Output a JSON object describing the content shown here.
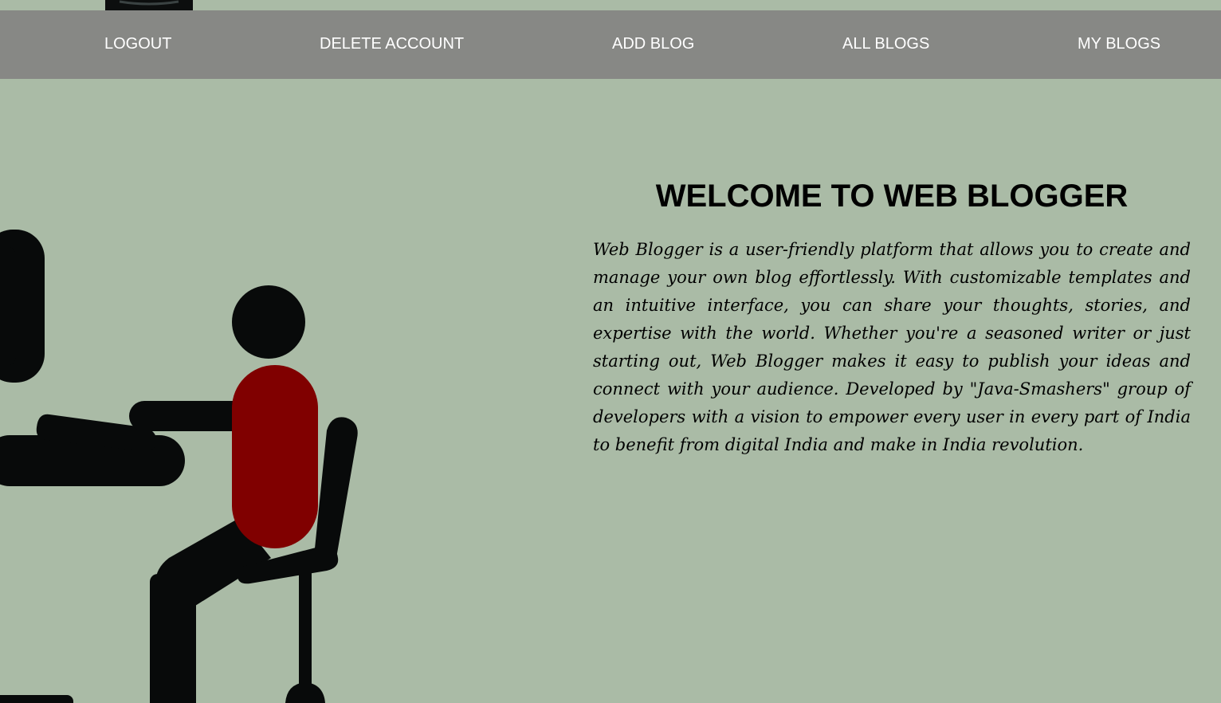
{
  "nav": {
    "logout": "LOGOUT",
    "delete_account": "DELETE ACCOUNT",
    "add_blog": "ADD BLOG",
    "all_blogs": "ALL BLOGS",
    "my_blogs": "MY BLOGS"
  },
  "hero": {
    "title": "WELCOME TO WEB BLOGGER",
    "description": "Web Blogger is a user-friendly platform that allows you to create and manage your own blog effortlessly. With customizable templates and an intuitive interface, you can share your thoughts, stories, and expertise with the world. Whether you're a seasoned writer or just starting out, Web Blogger makes it easy to publish your ideas and connect with your audience. Developed by \"Java-Smashers\" group of developers with a vision to empower every user in every part of India to benefit from digital India and make in India revolution."
  },
  "colors": {
    "background": "#aabba6",
    "navbar": "#878885",
    "nav_text": "#ffffff",
    "figure": "#080a0a",
    "shirt": "#800000"
  },
  "icons": {
    "lamp": "hanging-lamp-icon",
    "illustration": "person-at-computer-illustration"
  }
}
